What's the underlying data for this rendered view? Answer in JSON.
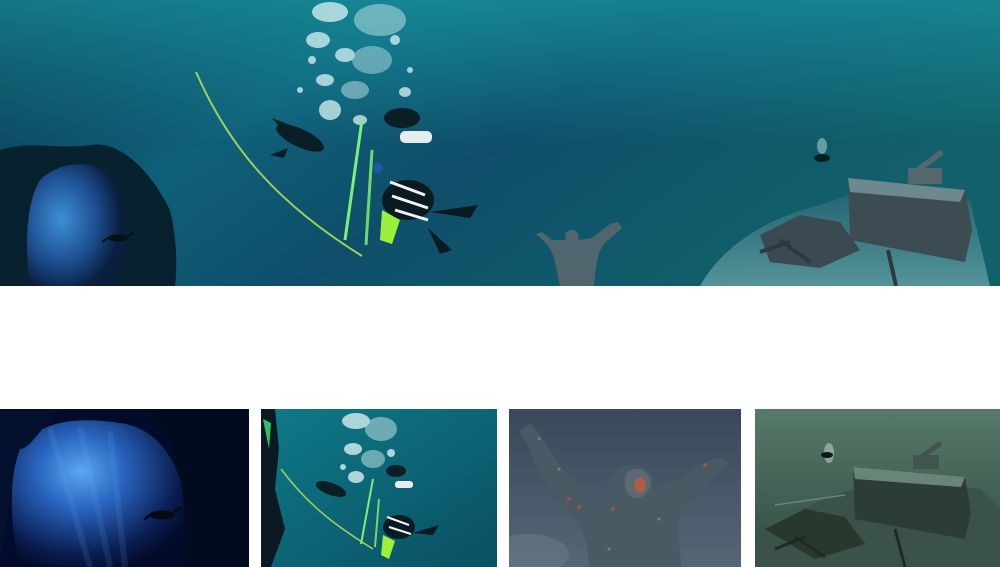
{
  "hero": {
    "scenes": [
      "cave-entrance-with-diver",
      "descent-line-divers",
      "submerged-christ-statue",
      "shipwreck-with-cannon"
    ],
    "colors": {
      "deep": "#0a3a4e",
      "mid": "#11607a",
      "surface": "#1a8a9a",
      "bubbles": "#d8f4f4"
    }
  },
  "thumbnails": [
    {
      "scene": "cave-entrance-diver",
      "colors": {
        "bg": "#020c2a",
        "glow": "#3a88d8"
      }
    },
    {
      "scene": "descent-line-divers",
      "colors": {
        "bg": "#0b5f73",
        "glow": "#6fd1d4"
      }
    },
    {
      "scene": "christ-of-the-abyss-statue",
      "colors": {
        "bg": "#3c4b58",
        "glow": "#8a98a4"
      }
    },
    {
      "scene": "shipwreck-cannon",
      "colors": {
        "bg": "#3d5a50",
        "glow": "#7c9a8a"
      }
    }
  ]
}
